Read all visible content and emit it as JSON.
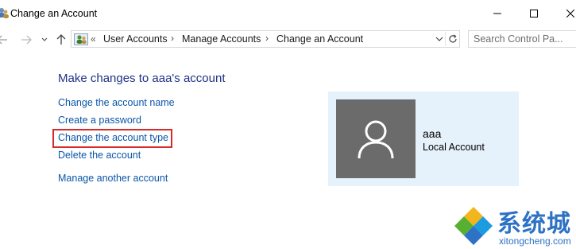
{
  "window": {
    "title": "Change an Account",
    "controls": [
      "minimize",
      "maximize",
      "close"
    ]
  },
  "nav": {
    "back_icon": "back-arrow-icon",
    "forward_icon": "forward-arrow-icon",
    "recent_icon": "chevron-down-icon",
    "up_icon": "up-arrow-icon"
  },
  "address": {
    "overflow": "«",
    "crumbs": [
      "User Accounts",
      "Manage Accounts",
      "Change an Account"
    ],
    "separator": "›"
  },
  "search": {
    "placeholder": "Search Control Pa..."
  },
  "main": {
    "heading": "Make changes to aaa's account",
    "links": [
      "Change the account name",
      "Create a password",
      "Change the account type",
      "Delete the account",
      "Manage another account"
    ],
    "highlighted_link_index": 2
  },
  "account": {
    "name": "aaa",
    "type": "Local Account",
    "avatar_icon": "user-silhouette-icon"
  },
  "watermark": {
    "cn_text": "系统城",
    "en_text": "xitongcheng.com"
  },
  "colors": {
    "link": "#0a56a9",
    "heading": "#1e3287",
    "panel": "#e5f1fb",
    "avatar": "#6b6b6b",
    "highlight": "#d42a2a",
    "watermark": "#2d72c4"
  }
}
